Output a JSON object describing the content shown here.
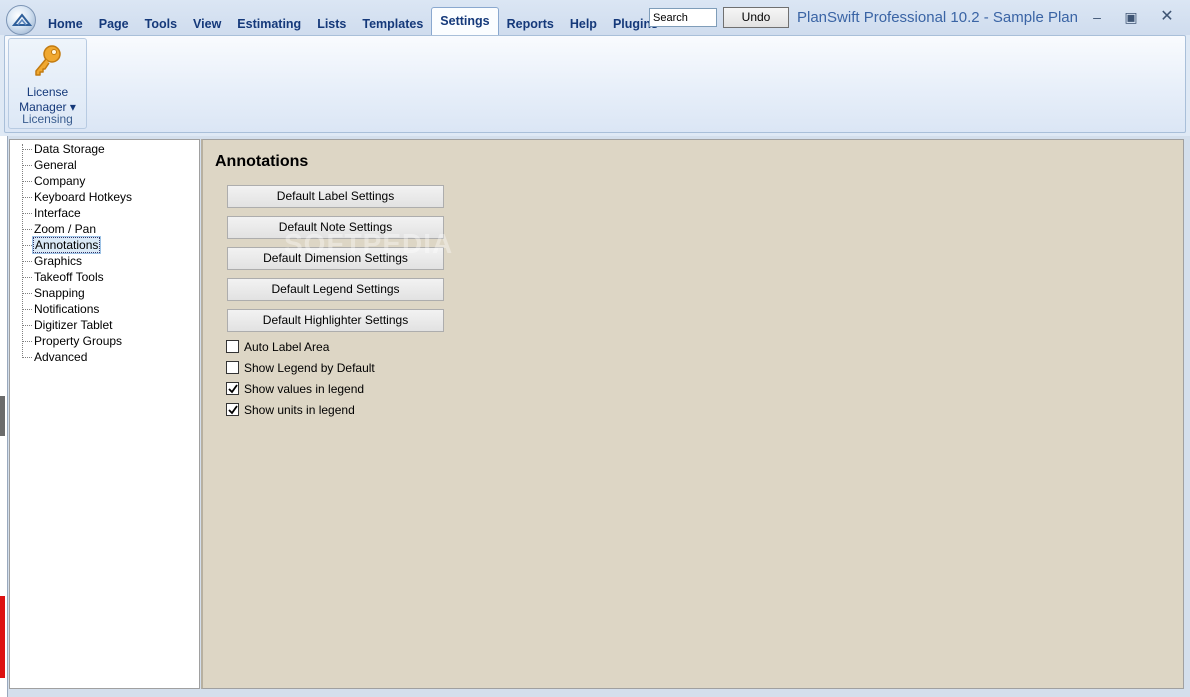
{
  "menu": {
    "tabs": [
      {
        "label": "Home"
      },
      {
        "label": "Page"
      },
      {
        "label": "Tools"
      },
      {
        "label": "View"
      },
      {
        "label": "Estimating"
      },
      {
        "label": "Lists"
      },
      {
        "label": "Templates"
      },
      {
        "label": "Settings",
        "active": true
      },
      {
        "label": "Reports"
      },
      {
        "label": "Help"
      },
      {
        "label": "Plugins"
      }
    ]
  },
  "search": {
    "value": "Search"
  },
  "undo": {
    "label": "Undo"
  },
  "window": {
    "title": "PlanSwift Professional 10.2 - Sample Plan",
    "minimize": "‒",
    "maximize": "▣",
    "close": "✕"
  },
  "ribbon": {
    "license_line1": "License",
    "license_line2": "Manager ▾",
    "group_label": "Licensing"
  },
  "tree": {
    "items": [
      {
        "label": "Data Storage"
      },
      {
        "label": "General"
      },
      {
        "label": "Company"
      },
      {
        "label": "Keyboard Hotkeys"
      },
      {
        "label": "Interface"
      },
      {
        "label": "Zoom / Pan"
      },
      {
        "label": "Annotations",
        "selected": true
      },
      {
        "label": "Graphics"
      },
      {
        "label": "Takeoff Tools"
      },
      {
        "label": "Snapping"
      },
      {
        "label": "Notifications"
      },
      {
        "label": "Digitizer Tablet"
      },
      {
        "label": "Property Groups"
      },
      {
        "label": "Advanced"
      }
    ]
  },
  "settings": {
    "title": "Annotations",
    "buttons": [
      {
        "label": "Default Label Settings"
      },
      {
        "label": "Default Note Settings"
      },
      {
        "label": "Default Dimension Settings"
      },
      {
        "label": "Default Legend Settings"
      },
      {
        "label": "Default Highlighter Settings"
      }
    ],
    "checkboxes": [
      {
        "label": "Auto Label Area",
        "checked": false
      },
      {
        "label": "Show Legend by Default",
        "checked": false
      },
      {
        "label": "Show values in legend",
        "checked": true
      },
      {
        "label": "Show units in legend",
        "checked": true
      }
    ]
  },
  "watermark": "SOFTPEDIA"
}
